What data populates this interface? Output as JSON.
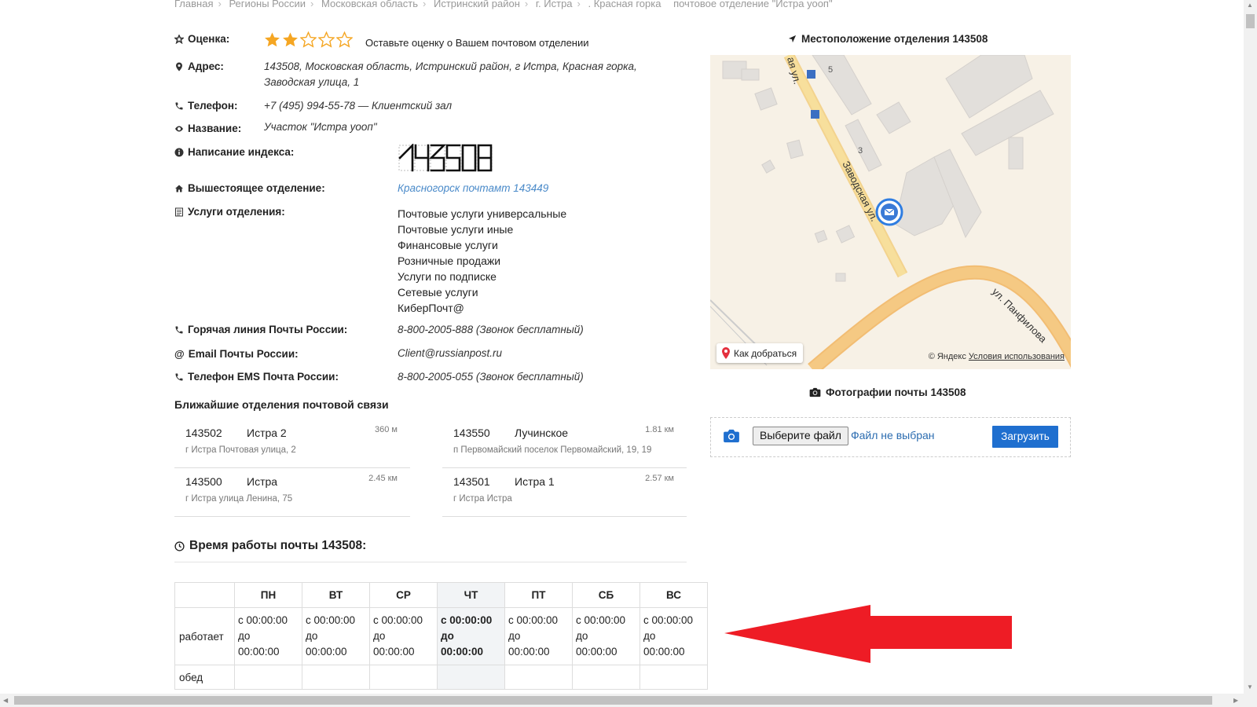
{
  "breadcrumb": [
    "Главная",
    "Регионы России",
    "Московская область",
    "Истринский район",
    "г. Истра",
    ". Красная горка",
    "почтовое отделение \"Истра уооп\""
  ],
  "rating": {
    "label": "Оценка:",
    "value": 2,
    "max": 5,
    "prompt": "Оставьте оценку о Вашем почтовом отделении"
  },
  "address": {
    "label": "Адрес:",
    "line1": "143508, Московская область, Истринский район, г Истра, Красная горка,",
    "line2": "Заводская улица, 1"
  },
  "phone": {
    "label": "Телефон:",
    "value": "+7 (495) 994-55-78 — Клиентский зал"
  },
  "name": {
    "label": "Название:",
    "value": "Участок \"Истра уооп\""
  },
  "index": {
    "label": "Написание индекса:",
    "value": "143508"
  },
  "parent": {
    "label": "Вышестоящее отделение:",
    "value": "Красногорск почтамт 143449"
  },
  "services": {
    "label": "Услуги отделения:",
    "items": [
      "Почтовые услуги универсальные",
      "Почтовые услуги иные",
      "Финансовые услуги",
      "Розничные продажи",
      "Услуги по подписке",
      "Сетевые услуги",
      "КиберПочт@"
    ]
  },
  "hotline": {
    "label": "Горячая линия Почты России:",
    "value": "8-800-2005-888 (Звонок бесплатный)"
  },
  "email": {
    "label": "Email Почты России:",
    "value": "Client@russianpost.ru"
  },
  "ems": {
    "label": "Телефон EMS Почта России:",
    "value": "8-800-2005-055 (Звонок бесплатный)"
  },
  "nearest": {
    "title": "Ближайшие отделения почтовой связи",
    "items": [
      {
        "code": "143502",
        "name": "Истра 2",
        "dist": "360 м",
        "addr": "г Истра Почтовая улица, 2"
      },
      {
        "code": "143550",
        "name": "Лучинское",
        "dist": "1.81 км",
        "addr": "п Первомайский поселок Первомайский, 19, 19"
      },
      {
        "code": "143500",
        "name": "Истра",
        "dist": "2.45 км",
        "addr": "г Истра улица Ленина, 75"
      },
      {
        "code": "143501",
        "name": "Истра 1",
        "dist": "2.57 км",
        "addr": "г Истра Истра"
      }
    ]
  },
  "hours": {
    "title": "Время работы почты 143508:",
    "days": [
      "ПН",
      "ВТ",
      "СР",
      "ЧТ",
      "ПТ",
      "СБ",
      "ВС"
    ],
    "today_index": 3,
    "row_work": "работает",
    "row_lunch": "обед",
    "from_prefix": "с 00:00:00",
    "to_prefix": "до",
    "to_time": "00:00:00"
  },
  "map": {
    "title": "Местоположение отделения 143508",
    "street1": "Заводская ул.",
    "street2": "ул. Панфилова",
    "street3": "ая ул.",
    "house5": "5",
    "house3": "3",
    "route": "Как добраться",
    "copyright": "© Яндекс",
    "terms": "Условия использования"
  },
  "photos": {
    "title": "Фотографии почты 143508",
    "choose": "Выберите файл",
    "status": "Файл не выбран",
    "upload": "Загрузить"
  },
  "colors": {
    "star": "#f5a623",
    "link": "#4a8ac9",
    "upload": "#1f6fcf",
    "arrow": "#ee1c25",
    "road": "#f3c680"
  }
}
